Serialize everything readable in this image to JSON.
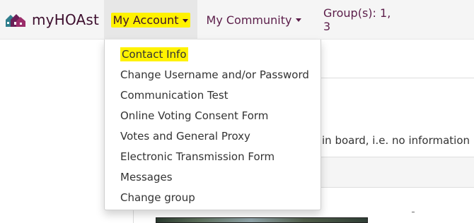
{
  "navbar": {
    "brand": "myHOAst",
    "my_account": "My Account",
    "my_community": "My Community",
    "groups": "Group(s): 1, 3"
  },
  "account_menu": {
    "items": [
      {
        "label": "Contact Info"
      },
      {
        "label": "Change Username and/or Password"
      },
      {
        "label": "Communication Test"
      },
      {
        "label": "Online Voting Consent Form"
      },
      {
        "label": "Votes and General Proxy"
      },
      {
        "label": "Electronic Transmission Form"
      },
      {
        "label": "Messages"
      },
      {
        "label": "Change group"
      }
    ]
  },
  "page": {
    "partial_text": "in board, i.e. no information is"
  },
  "colors": {
    "highlight": "#fff200",
    "nav_text": "#5c1e4a",
    "brand_text": "#3d0f2e"
  }
}
